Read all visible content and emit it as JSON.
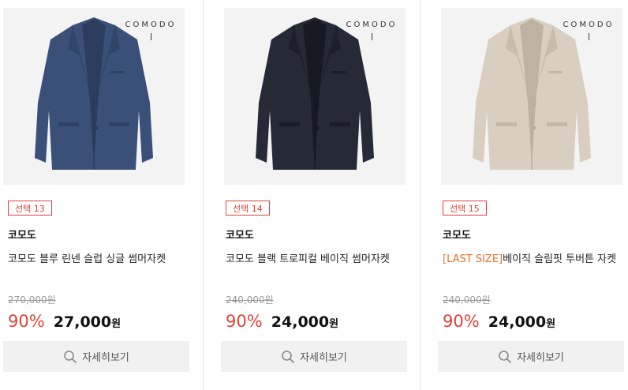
{
  "products": [
    {
      "logo": "COMODO",
      "select_badge": "선택 13",
      "brand": "코모도",
      "title_tag": "",
      "title": "코모도 블루 린넨 슬럽 싱글 썸머자켓",
      "original_price": "270,000원",
      "discount_rate": "90%",
      "sale_price": "27,000",
      "currency": "원",
      "detail_button": "자세히보기",
      "jacket_color": "#3b5079",
      "jacket_dark": "#2a3a5c",
      "icon": "magnifier-icon"
    },
    {
      "logo": "COMODO",
      "select_badge": "선택 14",
      "brand": "코모도",
      "title_tag": "",
      "title": "코모도 블랙 트로피컬 베이직 썸머자켓",
      "original_price": "240,000원",
      "discount_rate": "90%",
      "sale_price": "24,000",
      "currency": "원",
      "detail_button": "자세히보기",
      "jacket_color": "#262a36",
      "jacket_dark": "#15171f",
      "icon": "magnifier-icon"
    },
    {
      "logo": "COMODO",
      "select_badge": "선택 15",
      "brand": "코모도",
      "title_tag": "[LAST SIZE]",
      "title": "베이직 슬림핏 투버튼 자켓",
      "original_price": "240,000원",
      "discount_rate": "90%",
      "sale_price": "24,000",
      "currency": "원",
      "detail_button": "자세히보기",
      "jacket_color": "#d9cfc1",
      "jacket_dark": "#b9ad9c",
      "icon": "magnifier-icon"
    }
  ],
  "colors": {
    "accent_red": "#e0423a",
    "tag_orange": "#e8702a",
    "button_bg": "#f1f1f1"
  }
}
